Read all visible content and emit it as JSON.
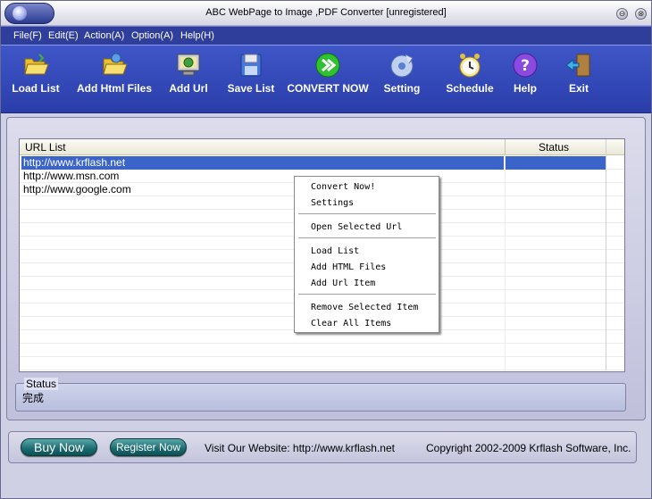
{
  "window": {
    "title": "ABC WebPage to Image ,PDF Converter [unregistered]"
  },
  "title_buttons": {
    "minimize": "⊖",
    "close": "⊗"
  },
  "menubar": [
    "File(F)",
    "Edit(E)",
    "Action(A)",
    "Option(A)",
    "Help(H)"
  ],
  "toolbar": [
    {
      "label": "Load List",
      "icon": "folder-open-icon"
    },
    {
      "label": "Add Html Files",
      "icon": "folder-add-icon"
    },
    {
      "label": "Add Url",
      "icon": "monitor-globe-icon"
    },
    {
      "label": "Save List",
      "icon": "floppy-disk-icon"
    },
    {
      "label": "CONVERT NOW",
      "icon": "green-arrow-icon"
    },
    {
      "label": "Setting",
      "icon": "settings-disc-icon"
    },
    {
      "label": "Schedule",
      "icon": "alarm-clock-icon"
    },
    {
      "label": "Help",
      "icon": "help-question-icon"
    },
    {
      "label": "Exit",
      "icon": "exit-door-icon"
    }
  ],
  "list": {
    "columns": [
      "URL List",
      "Status"
    ],
    "rows": [
      {
        "url": "http://www.krflash.net",
        "status": "",
        "selected": true
      },
      {
        "url": "http://www.msn.com",
        "status": "",
        "selected": false
      },
      {
        "url": "http://www.google.com",
        "status": "",
        "selected": false
      }
    ]
  },
  "context_menu": {
    "groups": [
      [
        "Convert Now!",
        "Settings"
      ],
      [
        "Open Selected Url"
      ],
      [
        "Load List",
        "Add HTML Files",
        "Add Url Item"
      ],
      [
        "Remove Selected Item",
        "Clear All Items"
      ]
    ]
  },
  "status": {
    "legend": "Status",
    "value": "完成"
  },
  "bottom": {
    "buy_label": "Buy Now",
    "register_label": "Register Now",
    "website_text": "Visit Our Website: http://www.krflash.net",
    "copyright": "Copyright 2002-2009 Krflash Software, Inc."
  },
  "colors": {
    "toolbar": "#2a3eaa",
    "menubar": "#2e3e9a",
    "selection": "#3a64c8",
    "oval_button": "#1a6a70"
  }
}
